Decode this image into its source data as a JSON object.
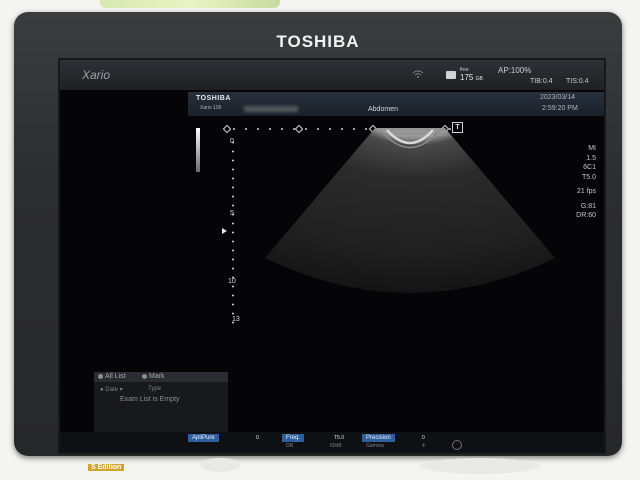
{
  "device": {
    "brand": "TOSHIBA"
  },
  "colors": {
    "accent": "#2f5f9e",
    "screen_bg": "#050507",
    "text": "#c4c8ce"
  },
  "topbar": {
    "model_logo": "Xario",
    "free_label": "free",
    "free_value": "175",
    "free_unit": "GB",
    "ap": "AP:100%",
    "tib": "TIB:0.4",
    "tis": "TIS:0.4"
  },
  "infobar": {
    "brand": "TOSHIBA",
    "model": "Xario 100",
    "study": "Abdomen",
    "date": "2023/03/14",
    "time": "2:59:20 PM"
  },
  "image": {
    "depth_labels": [
      "0",
      "5",
      "10",
      "13"
    ],
    "marker": "T"
  },
  "params": {
    "mi_label": "MI",
    "mi_value": "1.5",
    "probe": "6C1",
    "tgc": "T5.0",
    "fps": "21 fps",
    "gain": "G:81",
    "dr": "DR:60"
  },
  "exam_panel": {
    "tab_all": "All List",
    "tab_mark": "Mark",
    "sort_date": "Date",
    "sort_type": "Type",
    "empty_message": "Exam List is Empty"
  },
  "menu": [
    {
      "label": "ApliPure",
      "value": "0",
      "sub": ""
    },
    {
      "label": "Freq.",
      "value": "T5.0",
      "sub_left": "DR",
      "sub_right": "60dB"
    },
    {
      "label": "Precision",
      "value": "0",
      "sub_left": "Gamma",
      "sub_right": "4"
    }
  ],
  "chin_label": "S Edition"
}
